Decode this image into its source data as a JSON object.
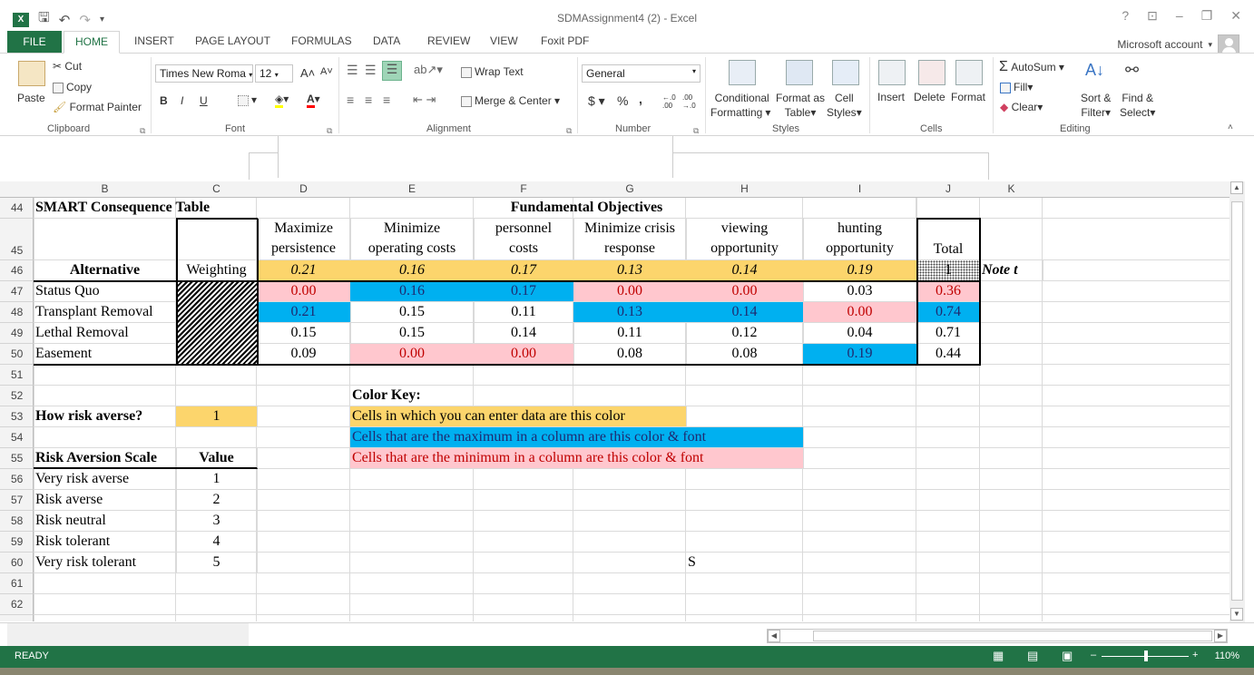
{
  "window": {
    "title": "SDMAssignment4 (2) - Excel",
    "help": "?",
    "ribbon_options": "⊡",
    "minimize": "–",
    "restore": "❐",
    "close": "✕"
  },
  "qat": {
    "save_icon": "save-icon",
    "undo_icon": "undo-icon",
    "redo_icon": "redo-icon"
  },
  "tabs": [
    "FILE",
    "HOME",
    "INSERT",
    "PAGE LAYOUT",
    "FORMULAS",
    "DATA",
    "REVIEW",
    "VIEW",
    "Foxit PDF"
  ],
  "account": "Microsoft account",
  "ribbon": {
    "clipboard": {
      "paste": "Paste",
      "cut": "Cut",
      "copy": "Copy",
      "format_painter": "Format Painter",
      "label": "Clipboard"
    },
    "font": {
      "name": "Times New Roma",
      "size": "12",
      "bold": "B",
      "italic": "I",
      "underline": "U",
      "grow": "A˄",
      "shrink": "A˅",
      "label": "Font"
    },
    "alignment": {
      "wrap": "Wrap Text",
      "merge": "Merge & Center",
      "label": "Alignment"
    },
    "number": {
      "format": "General",
      "currency": "$",
      "percent": "%",
      "comma": ",",
      "inc_dec": "←.0 .00",
      "dec_dec": ".00 →.0",
      "label": "Number"
    },
    "styles": {
      "conditional": "Conditional",
      "conditional2": "Formatting",
      "format_as": "Format as",
      "format_as2": "Table",
      "cell": "Cell",
      "cell2": "Styles",
      "label": "Styles"
    },
    "cells": {
      "insert": "Insert",
      "delete": "Delete",
      "format": "Format",
      "label": "Cells"
    },
    "editing": {
      "autosum": "AutoSum",
      "fill": "Fill",
      "clear": "Clear",
      "sort": "Sort &",
      "sort2": "Filter",
      "find": "Find &",
      "find2": "Select",
      "label": "Editing"
    }
  },
  "columns": [
    "B",
    "C",
    "D",
    "E",
    "F",
    "G",
    "H",
    "I",
    "J",
    "K"
  ],
  "rows": [
    "44",
    "45",
    "46",
    "47",
    "48",
    "49",
    "50",
    "51",
    "52",
    "53",
    "54",
    "55",
    "56",
    "57",
    "58",
    "59",
    "60",
    "61",
    "62"
  ],
  "sheet": {
    "r44": {
      "title": "SMART Consequence Table",
      "objectives": "Fundamental Objectives"
    },
    "r45": {
      "d1": "Maximize",
      "d2": "persistence",
      "e1": "Minimize",
      "e2": "operating costs",
      "f1": "personnel",
      "f2": "costs",
      "g1": "Minimize crisis",
      "g2": "response",
      "h1": "viewing",
      "h2": "opportunity",
      "i1": "hunting",
      "i2": "opportunity",
      "j": "Total"
    },
    "r46": {
      "b": "Alternative",
      "c": "Weighting",
      "d": "0.21",
      "e": "0.16",
      "f": "0.17",
      "g": "0.13",
      "h": "0.14",
      "i": "0.19",
      "j": "1",
      "k": "Note t"
    },
    "r47": {
      "b": "Status Quo",
      "d": "0.00",
      "e": "0.16",
      "f": "0.17",
      "g": "0.00",
      "h": "0.00",
      "i": "0.03",
      "j": "0.36"
    },
    "r48": {
      "b": "Transplant Removal",
      "d": "0.21",
      "e": "0.15",
      "f": "0.11",
      "g": "0.13",
      "h": "0.14",
      "i": "0.00",
      "j": "0.74"
    },
    "r49": {
      "b": "Lethal Removal",
      "d": "0.15",
      "e": "0.15",
      "f": "0.14",
      "g": "0.11",
      "h": "0.12",
      "i": "0.04",
      "j": "0.71"
    },
    "r50": {
      "b": "Easement",
      "d": "0.09",
      "e": "0.00",
      "f": "0.00",
      "g": "0.08",
      "h": "0.08",
      "i": "0.19",
      "j": "0.44"
    },
    "r52": {
      "e": "Color Key:"
    },
    "r53": {
      "b": "How risk averse?",
      "c": "1",
      "e": "Cells in which you can enter data are this color"
    },
    "r54": {
      "e": "Cells that are the maximum in a column are this color & font"
    },
    "r55": {
      "b": "Risk Aversion Scale",
      "c": "Value",
      "e": "Cells that are the minimum in a column are this color & font"
    },
    "r56": {
      "b": "Very risk averse",
      "c": "1"
    },
    "r57": {
      "b": "Risk averse",
      "c": "2"
    },
    "r58": {
      "b": "Risk neutral",
      "c": "3"
    },
    "r59": {
      "b": "Risk tolerant",
      "c": "4"
    },
    "r60": {
      "b": "Very risk tolerant",
      "c": "5",
      "h": "S"
    }
  },
  "status": {
    "ready": "READY",
    "zoom": "110%"
  },
  "colors": {
    "excel_green": "#217346",
    "input_yellow": "#fcd56c",
    "max_blue": "#00b0f0",
    "min_pink": "#ffc7ce",
    "min_font_red": "#c00000"
  }
}
